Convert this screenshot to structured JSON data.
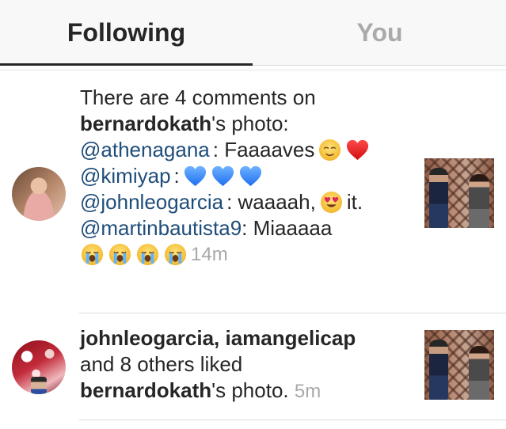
{
  "tabs": {
    "following": "Following",
    "you": "You",
    "active": "Following"
  },
  "feed": [
    {
      "type": "comments",
      "intro_before": "There are 4 comments on",
      "photo_owner": "bernardokath",
      "photo_suffix": "'s photo:",
      "comments": [
        {
          "mention": "@athenagana",
          "text": ": Faaaaves",
          "emojis": [
            "relieved-face",
            "red-heart"
          ]
        },
        {
          "mention": "@kimiyap",
          "text": ":",
          "emojis": [
            "blue-heart",
            "blue-heart",
            "blue-heart"
          ]
        },
        {
          "mention": "@johnleogarcia",
          "text": ": waaaah,",
          "emojis": [
            "heart-eyes-face"
          ],
          "text_after": "it."
        },
        {
          "mention": "@martinbautista9",
          "text": ": Miaaaaa",
          "emojis": [
            "loudly-crying-face",
            "loudly-crying-face",
            "loudly-crying-face",
            "loudly-crying-face"
          ]
        }
      ],
      "time": "14m"
    },
    {
      "type": "likes",
      "likers": "johnleogarcia, iamangelicap",
      "others": "and 8 others liked",
      "photo_owner": "bernardokath",
      "photo_suffix": "'s photo.",
      "time": "5m"
    }
  ],
  "colors": {
    "mention": "#1f4d7a",
    "timestamp": "#a8a8a8",
    "active_tab": "#262626",
    "inactive_tab": "#aaaaaa"
  }
}
